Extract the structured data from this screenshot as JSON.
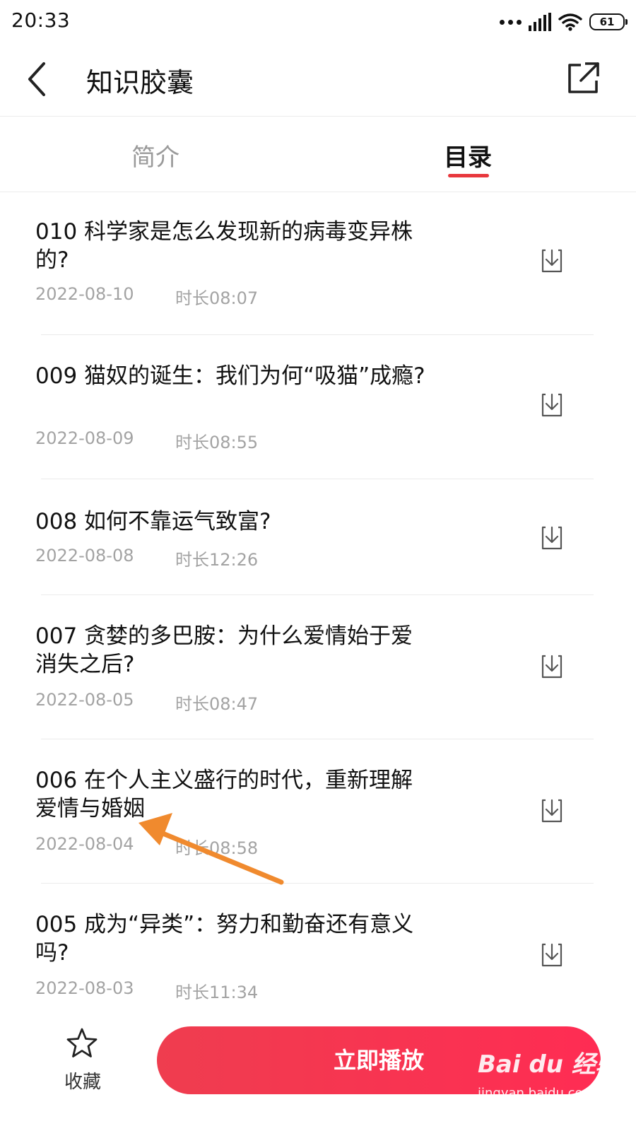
{
  "status_bar": {
    "time": "20:33",
    "battery": "61"
  },
  "header": {
    "title": "知识胶囊"
  },
  "tabs": [
    {
      "label": "简介",
      "active": false
    },
    {
      "label": "目录",
      "active": true
    }
  ],
  "episodes": [
    {
      "title": "010 科学家是怎么发现新的病毒变异株的?",
      "date": "2022-08-10",
      "duration": "时长08:07"
    },
    {
      "title": "009 猫奴的诞生：我们为何“吸猫”成瘾?",
      "date": "2022-08-09",
      "duration": "时长08:55"
    },
    {
      "title": "008 如何不靠运气致富?",
      "date": "2022-08-08",
      "duration": "时长12:26"
    },
    {
      "title": "007 贪婪的多巴胺：为什么爱情始于爱消失之后?",
      "date": "2022-08-05",
      "duration": "时长08:47"
    },
    {
      "title": "006 在个人主义盛行的时代，重新理解爱情与婚姻",
      "date": "2022-08-04",
      "duration": "时长08:58"
    },
    {
      "title": "005 成为“异类”：努力和勤奋还有意义吗?",
      "date": "2022-08-03",
      "duration": "时长11:34"
    }
  ],
  "bottom_bar": {
    "favorite_label": "收藏",
    "play_label": "立即播放"
  },
  "watermark": {
    "logo": "Bai du 经验",
    "url": "jingyan.baidu.com"
  },
  "annotation": {
    "color": "#f08a2e"
  },
  "colors": {
    "accent": "#e8383d",
    "play_button": "#f53650",
    "meta_text": "#a3a3a3"
  }
}
